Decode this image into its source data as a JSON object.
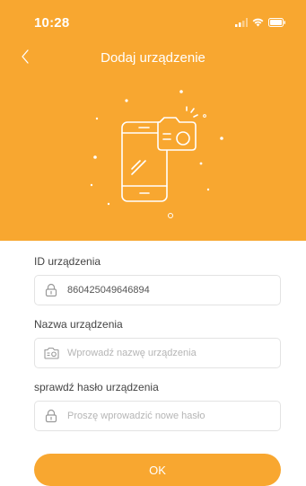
{
  "status_bar": {
    "time": "10:28"
  },
  "nav": {
    "title": "Dodaj urządzenie"
  },
  "form": {
    "device_id": {
      "label": "ID urządzenia",
      "value": "860425049646894"
    },
    "device_name": {
      "label": "Nazwa urządzenia",
      "placeholder": "Wprowadź nazwę urządzenia"
    },
    "password": {
      "label": "sprawdź hasło urządzenia",
      "placeholder": "Proszę wprowadzić nowe hasło"
    }
  },
  "actions": {
    "ok_label": "OK"
  },
  "colors": {
    "accent": "#F8A730",
    "input_border": "#E3E3E3",
    "white": "#FFFFFF"
  },
  "icons": [
    "back-chevron-icon",
    "signal-icon",
    "wifi-icon",
    "battery-icon",
    "phone-camera-illustration",
    "lock-icon",
    "camera-icon"
  ]
}
